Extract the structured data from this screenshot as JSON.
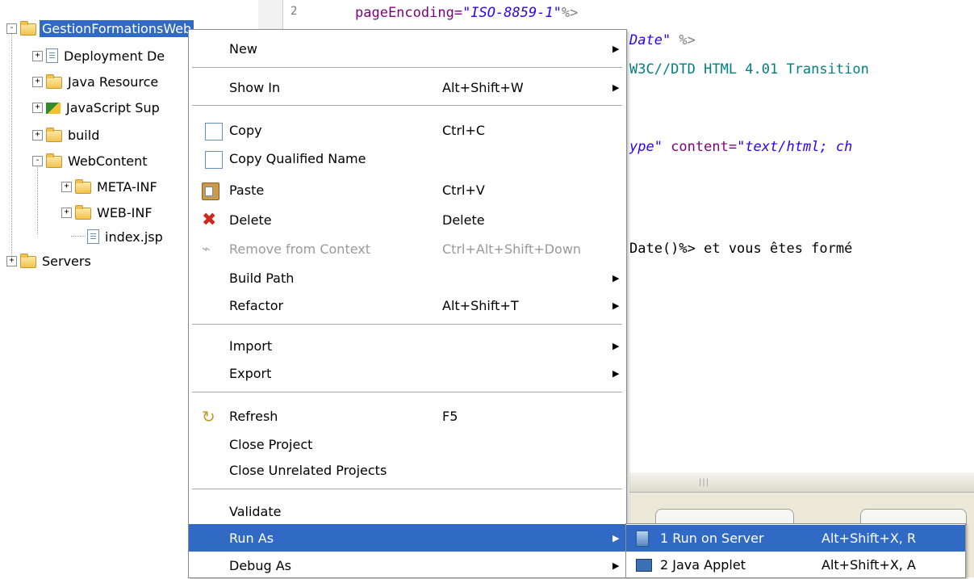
{
  "tree": {
    "project": "GestionFormationsWeb",
    "items": [
      {
        "label": "Deployment De",
        "expander": "+"
      },
      {
        "label": "Java Resource",
        "expander": "+"
      },
      {
        "label": "JavaScript Sup",
        "expander": "+"
      },
      {
        "label": "build",
        "expander": "+"
      },
      {
        "label": "WebContent",
        "expander": "-"
      },
      {
        "label": "META-INF",
        "expander": "+"
      },
      {
        "label": "WEB-INF",
        "expander": "+"
      },
      {
        "label": "index.jsp",
        "expander": ""
      },
      {
        "label": "Servers",
        "expander": "+"
      }
    ],
    "project_expander": "-"
  },
  "editor": {
    "line_number": "2",
    "lines": [
      {
        "a": "pageEncoding=",
        "b": "\"ISO-8859-1\"",
        "c": "%>"
      },
      {
        "a": "",
        "b": "Date\"",
        "c": " %>"
      },
      {
        "a": "",
        "b": "",
        "c": "",
        "plain": "W3C//DTD HTML 4.01 Transition"
      },
      {
        "a": "ype\"",
        "b": " content=",
        "c": "\"text/html; ch"
      },
      {
        "a": "",
        "b": "",
        "c": "",
        "plain": " Date()%> et vous êtes formé"
      }
    ]
  },
  "menu": {
    "items": [
      {
        "label": "New",
        "shortcut": "",
        "arrow": "▶"
      },
      {
        "label": "Show In",
        "shortcut": "Alt+Shift+W",
        "arrow": "▶"
      },
      {
        "label": "Copy",
        "shortcut": "Ctrl+C",
        "arrow": ""
      },
      {
        "label": "Copy Qualified Name",
        "shortcut": "",
        "arrow": ""
      },
      {
        "label": "Paste",
        "shortcut": "Ctrl+V",
        "arrow": ""
      },
      {
        "label": "Delete",
        "shortcut": "Delete",
        "arrow": ""
      },
      {
        "label": "Remove from Context",
        "shortcut": "Ctrl+Alt+Shift+Down",
        "arrow": ""
      },
      {
        "label": "Build Path",
        "shortcut": "",
        "arrow": "▶"
      },
      {
        "label": "Refactor",
        "shortcut": "Alt+Shift+T",
        "arrow": "▶"
      },
      {
        "label": "Import",
        "shortcut": "",
        "arrow": "▶"
      },
      {
        "label": "Export",
        "shortcut": "",
        "arrow": "▶"
      },
      {
        "label": "Refresh",
        "shortcut": "F5",
        "arrow": ""
      },
      {
        "label": "Close Project",
        "shortcut": "",
        "arrow": ""
      },
      {
        "label": "Close Unrelated Projects",
        "shortcut": "",
        "arrow": ""
      },
      {
        "label": "Validate",
        "shortcut": "",
        "arrow": ""
      },
      {
        "label": "Run As",
        "shortcut": "",
        "arrow": "▶"
      },
      {
        "label": "Debug As",
        "shortcut": "",
        "arrow": "▶"
      }
    ]
  },
  "submenu": {
    "items": [
      {
        "label": "1 Run on Server",
        "shortcut": "Alt+Shift+X, R"
      },
      {
        "label": "2 Java Applet",
        "shortcut": "Alt+Shift+X, A"
      }
    ]
  },
  "colors": {
    "selection": "#316ac5",
    "attr": "#7f007f",
    "string": "#2a00ff"
  }
}
